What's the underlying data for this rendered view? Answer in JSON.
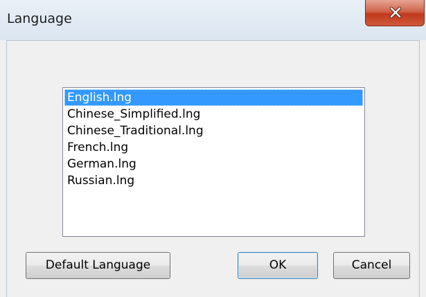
{
  "window": {
    "title": "Language"
  },
  "close_button": {
    "icon": "close-icon"
  },
  "language_list": {
    "items": [
      {
        "label": "English.lng",
        "selected": true
      },
      {
        "label": "Chinese_Simplified.lng",
        "selected": false
      },
      {
        "label": "Chinese_Traditional.lng",
        "selected": false
      },
      {
        "label": "French.lng",
        "selected": false
      },
      {
        "label": "German.lng",
        "selected": false
      },
      {
        "label": "Russian.lng",
        "selected": false
      }
    ]
  },
  "buttons": {
    "default_language": "Default Language",
    "ok": "OK",
    "cancel": "Cancel"
  },
  "colors": {
    "selection": "#3399ff",
    "close_button": "#c1391d"
  }
}
